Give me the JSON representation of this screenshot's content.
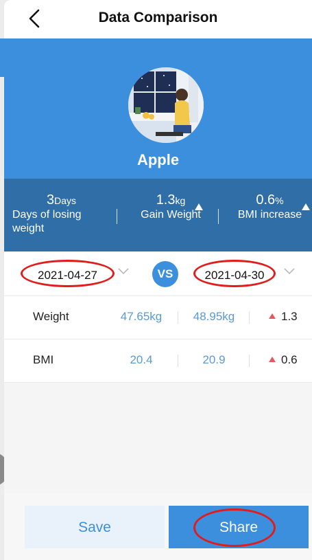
{
  "header": {
    "title": "Data Comparison"
  },
  "profile": {
    "name": "Apple"
  },
  "stats": [
    {
      "value": "3",
      "unit": "Days",
      "label": "Days of losing weight"
    },
    {
      "value": "1.3",
      "unit": "kg",
      "label": "Gain Weight",
      "trend": "up"
    },
    {
      "value": "0.6",
      "unit": "%",
      "label": "BMI increase",
      "trend": "up"
    }
  ],
  "compare": {
    "date_a": "2021-04-27",
    "vs_label": "VS",
    "date_b": "2021-04-30"
  },
  "rows": [
    {
      "label": "Weight",
      "value_a": "47.65kg",
      "value_b": "48.95kg",
      "diff": "1.3",
      "trend": "up"
    },
    {
      "label": "BMI",
      "value_a": "20.4",
      "value_b": "20.9",
      "diff": "0.6",
      "trend": "up"
    }
  ],
  "actions": {
    "save_label": "Save",
    "share_label": "Share"
  },
  "colors": {
    "primary": "#3b8fdd",
    "stats_bg": "#2f6ea6",
    "increase": "#e8575b",
    "highlight_ring": "#e21b1b"
  }
}
